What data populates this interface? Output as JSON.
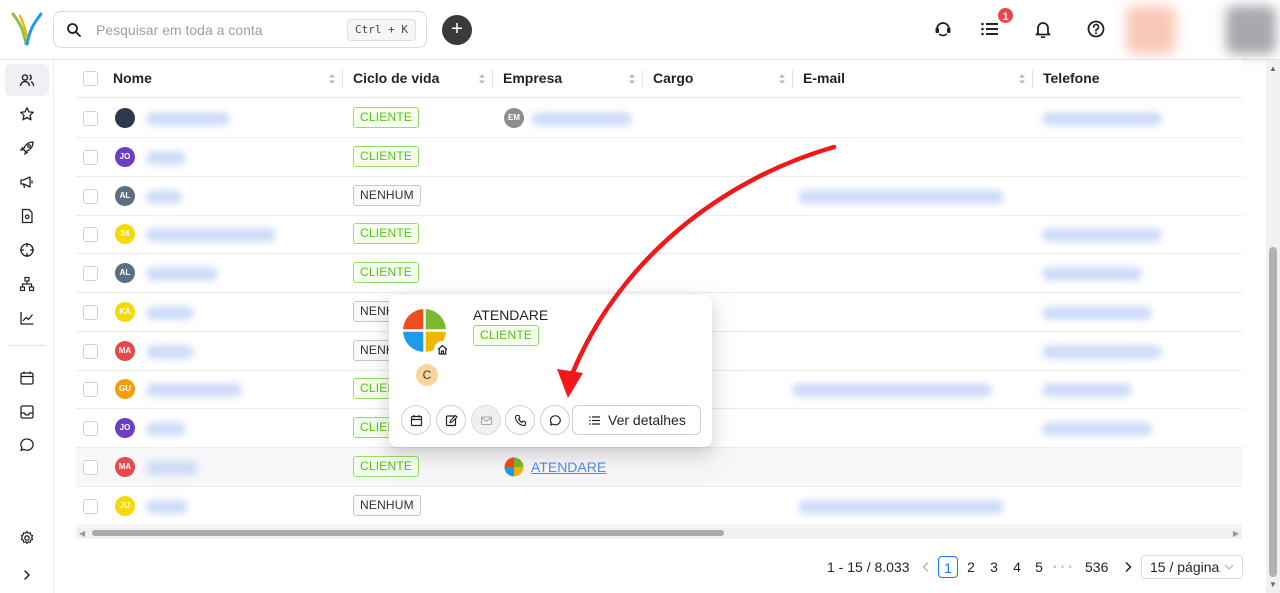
{
  "search": {
    "placeholder": "Pesquisar em toda a conta",
    "shortcut": "Ctrl + K"
  },
  "header": {
    "notification_count": "1"
  },
  "table": {
    "columns": [
      "Nome",
      "Ciclo de vida",
      "Empresa",
      "Cargo",
      "E-mail",
      "Telefone"
    ],
    "rows": [
      {
        "initials": "",
        "avatar_color": "#2b3a4a",
        "lifecycle": "CLIENTE",
        "lifecycle_type": "cli",
        "company_initials": "EM"
      },
      {
        "initials": "JO",
        "avatar_color": "#6b3fc4",
        "lifecycle": "CLIENTE",
        "lifecycle_type": "cli"
      },
      {
        "initials": "AL",
        "avatar_color": "#5c6f80",
        "lifecycle": "NENHUM",
        "lifecycle_type": "nen"
      },
      {
        "initials": "24",
        "avatar_color": "#f5d90a",
        "lifecycle": "CLIENTE",
        "lifecycle_type": "cli"
      },
      {
        "initials": "AL",
        "avatar_color": "#5c6f80",
        "lifecycle": "CLIENTE",
        "lifecycle_type": "cli"
      },
      {
        "initials": "KA",
        "avatar_color": "#f5d90a",
        "lifecycle": "NENHUM",
        "lifecycle_type": "nen"
      },
      {
        "initials": "MA",
        "avatar_color": "#e5484d",
        "lifecycle": "NENHUM",
        "lifecycle_type": "nen"
      },
      {
        "initials": "GU",
        "avatar_color": "#f59e0b",
        "lifecycle": "CLIENTE",
        "lifecycle_type": "cli"
      },
      {
        "initials": "JO",
        "avatar_color": "#6b3fc4",
        "lifecycle": "CLIENTE",
        "lifecycle_type": "cli"
      },
      {
        "initials": "MA",
        "avatar_color": "#e5484d",
        "lifecycle": "CLIENTE",
        "lifecycle_type": "cli",
        "company": "ATENDARE"
      },
      {
        "initials": "JU",
        "avatar_color": "#f5d90a",
        "lifecycle": "NENHUM",
        "lifecycle_type": "nen"
      }
    ]
  },
  "popover": {
    "company_name": "ATENDARE",
    "lifecycle": "CLIENTE",
    "owner_initial": "C",
    "details_label": "Ver detalhes"
  },
  "pagination": {
    "range": "1 - 15 / 8.033",
    "pages": [
      "1",
      "2",
      "3",
      "4",
      "5"
    ],
    "ellipsis": "• • •",
    "last_page": "536",
    "page_size": "15 / página"
  }
}
